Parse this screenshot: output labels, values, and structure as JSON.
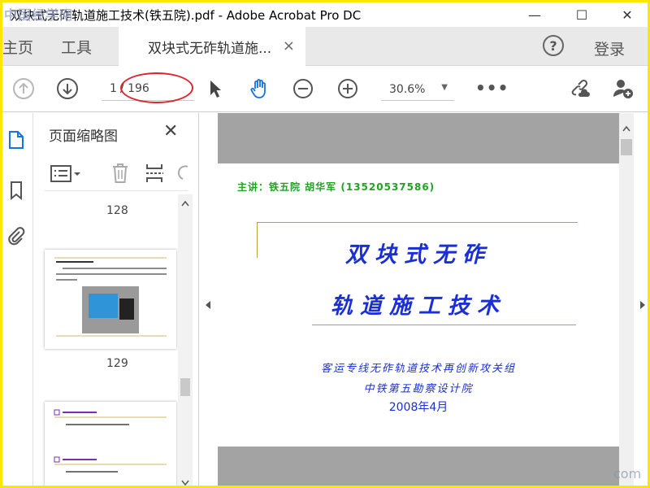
{
  "window": {
    "title": "双块式无砟轨道施工技术(铁五院).pdf - Adobe Acrobat Pro DC",
    "watermark": "中国经学网",
    "minimize": "—",
    "maximize": "☐",
    "close": "✕"
  },
  "tabs": {
    "home": "主页",
    "tools": "工具",
    "document": "双块式无砟轨道施...",
    "close": "×",
    "help": "?",
    "login": "登录"
  },
  "toolbar": {
    "current_page": "1",
    "separator_total": "/ 196",
    "zoom": "30.6%",
    "zoom_caret": "▼",
    "more": "•••"
  },
  "sidebar": {
    "panel_title": "页面缩略图",
    "close": "✕",
    "thumbnails": [
      {
        "page_label": "128"
      },
      {
        "page_label": "129"
      }
    ]
  },
  "document_page": {
    "presenter": "主讲：铁五院 胡华军 (13520537586)",
    "title_line1": "双块式无砟",
    "title_line2": "轨道施工技术",
    "org_line1": "客运专线无砟轨道技术再创新攻关组",
    "org_line2": "中铁第五勘察设计院",
    "date": "2008年4月"
  },
  "corner_watermark": "com"
}
